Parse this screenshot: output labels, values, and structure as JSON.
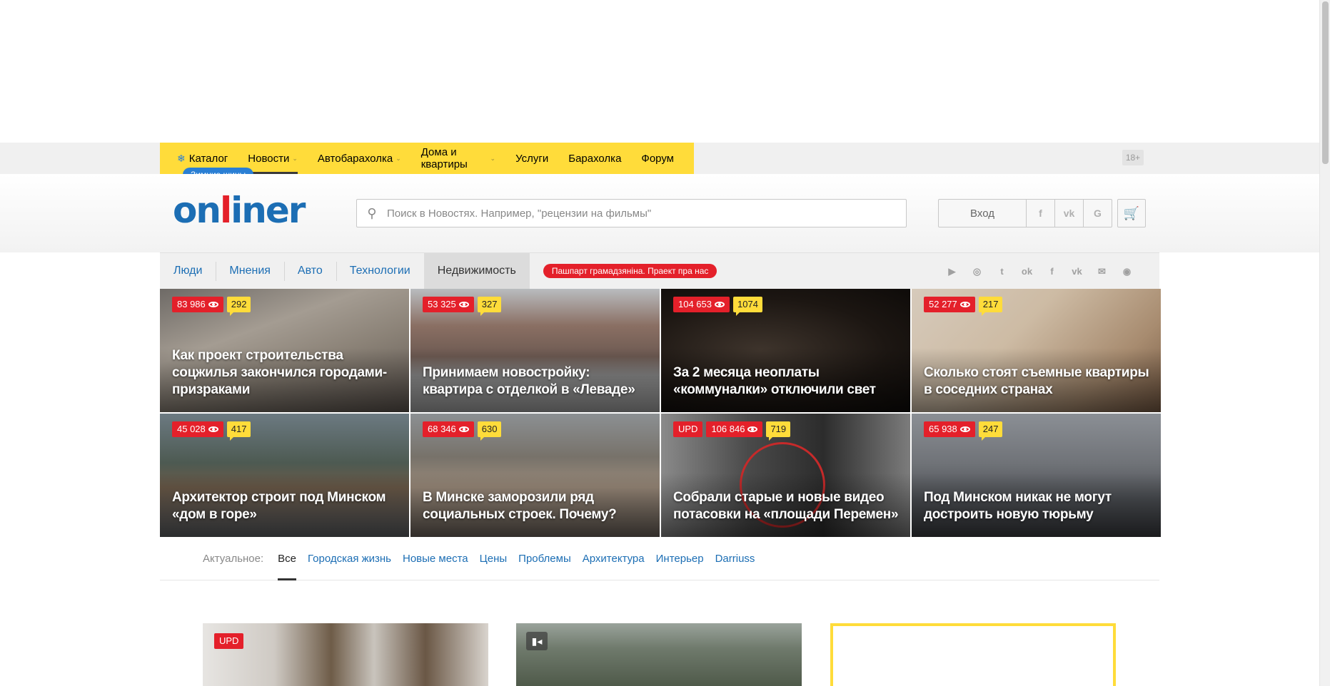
{
  "top_nav": {
    "items": [
      {
        "label": "Каталог",
        "icon": "snowflake-icon"
      },
      {
        "label": "Новости",
        "has_dropdown": true,
        "active": true
      },
      {
        "label": "Автобарахолка",
        "has_dropdown": true
      },
      {
        "label": "Дома и квартиры",
        "has_dropdown": true
      },
      {
        "label": "Услуги"
      },
      {
        "label": "Барахолка"
      },
      {
        "label": "Форум"
      }
    ],
    "catalog_tag": "Зимние шины",
    "age_label": "18+"
  },
  "header": {
    "logo_before": "on",
    "logo_red": "l",
    "logo_after": "iner",
    "search_placeholder": "Поиск в Новостях. Например, \"рецензии на фильмы\"",
    "login_label": "Вход",
    "social_login": [
      "f",
      "vk",
      "G"
    ]
  },
  "sections": {
    "tabs": [
      "Люди",
      "Мнения",
      "Авто",
      "Технологии",
      "Недвижимость"
    ],
    "active_tab": "Недвижимость",
    "promo": "Пашпарт грамадзяніна. Праект пра нас",
    "social_icons": [
      "youtube-icon",
      "instagram-icon",
      "twitter-icon",
      "odnoklassniki-icon",
      "facebook-icon",
      "vk-icon",
      "mail-icon",
      "rss-icon"
    ]
  },
  "tiles": [
    {
      "views": "83 986",
      "comments": "292",
      "title": "Как проект строительства соцжилья закончился городами-призраками"
    },
    {
      "views": "53 325",
      "comments": "327",
      "title": "Принимаем новостройку: квартира с отделкой в «Леваде»"
    },
    {
      "views": "104 653",
      "comments": "1074",
      "title": "За 2 месяца неоплаты «коммуналки» отключили свет"
    },
    {
      "views": "52 277",
      "comments": "217",
      "title": "Сколько стоят съемные квартиры в соседних странах"
    },
    {
      "views": "45 028",
      "comments": "417",
      "title": "Архитектор строит под Минском «дом в горе»"
    },
    {
      "views": "68 346",
      "comments": "630",
      "title": "В Минске заморозили ряд социальных строек. Почему?"
    },
    {
      "upd": "UPD",
      "views": "106 846",
      "comments": "719",
      "title": "Собрали старые и новые видео потасовки на «площади Перемен»"
    },
    {
      "views": "65 938",
      "comments": "247",
      "title": "Под Минском никак не могут достроить новую тюрьму"
    }
  ],
  "topics": {
    "label": "Актуальное:",
    "items": [
      "Все",
      "Городская жизнь",
      "Новые места",
      "Цены",
      "Проблемы",
      "Архитектура",
      "Интерьер",
      "Darriuss"
    ],
    "active": "Все"
  },
  "cards": {
    "first_badge": "UPD"
  },
  "colors": {
    "brand_blue": "#1c6eb4",
    "brand_yellow": "#ffdc3a",
    "brand_red": "#e4202a"
  }
}
